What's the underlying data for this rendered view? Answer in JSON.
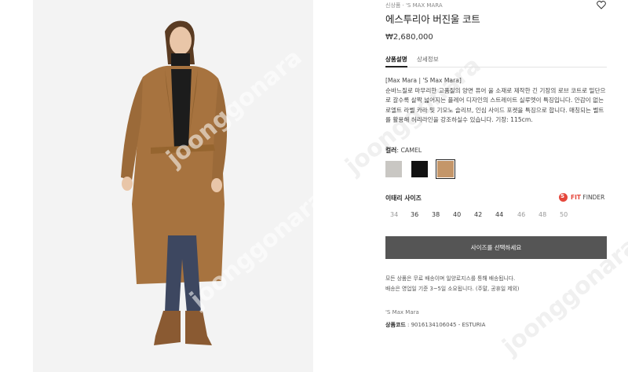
{
  "breadcrumb": "신상품 · 'S MAX MARA",
  "product": {
    "title": "에스투리아 버진울 코트",
    "price": "₩2,680,000"
  },
  "tabs": [
    "상품설명",
    "상세정보"
  ],
  "description": {
    "brand_line": "[Max Mara | 'S Max Mara]",
    "text": "순바느질로 마무리한 고품질의 양면 퓨어 울 소재로 제작한 긴 기장의 로브 코트로 밀단으로 갈수록 살짝 넓어지는 플레어 디자인의 스트레이트 실루엣이 특징입니다. 안감이 없는 로엘트 라벨 카라 및 기모노 슬리브, 인심 사이드 포켓을 특징으로 합니다. 매칭되는 벨트를 활용해 허리라인을 강조하실수 있습니다. 기장: 115cm."
  },
  "color": {
    "label": "컬러",
    "value": "CAMEL",
    "swatches": [
      {
        "name": "grey",
        "hex": "#c9c7c3"
      },
      {
        "name": "black",
        "hex": "#111111"
      },
      {
        "name": "camel",
        "hex": "#c49669"
      }
    ],
    "selected_index": 2
  },
  "size": {
    "label": "이태리 사이즈",
    "fit_finder_prefix": "FIT",
    "fit_finder_suffix": "FINDER",
    "fit_finder_icon": "S",
    "options": [
      {
        "label": "34",
        "available": false
      },
      {
        "label": "36",
        "available": true
      },
      {
        "label": "38",
        "available": true
      },
      {
        "label": "40",
        "available": true
      },
      {
        "label": "42",
        "available": true
      },
      {
        "label": "44",
        "available": true
      },
      {
        "label": "46",
        "available": false
      },
      {
        "label": "48",
        "available": false
      },
      {
        "label": "50",
        "available": false
      }
    ]
  },
  "select_button": "사이즈를 선택하세요",
  "shipping": {
    "line1": "모든 상품은 무료 배송이며 일양로지스를 통해 배송됩니다.",
    "line2": "배송은 영업일 기준 3~5일 소요됩니다. (주말, 공휴일 제외)"
  },
  "footer": {
    "brand": "'S Max Mara",
    "code_label": "상품코드",
    "code_value": " : 9016134106045 - ESTURIA"
  },
  "watermarks": [
    "joonggonara",
    "joonggonara",
    "joonggonara",
    "joonggonara"
  ],
  "colors": {
    "accent": "#e5463b",
    "coat": "#a7733f",
    "button": "#555555"
  }
}
